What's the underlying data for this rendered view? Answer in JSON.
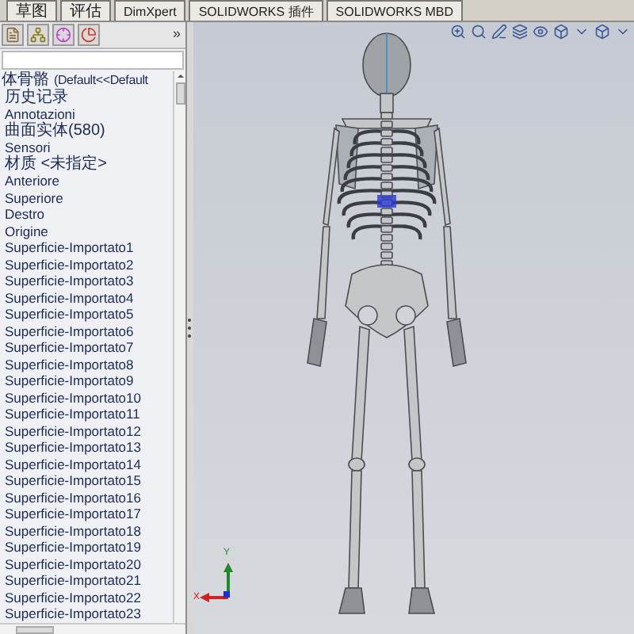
{
  "tabs": [
    {
      "label": "草图"
    },
    {
      "label": "评估"
    },
    {
      "label": "DimXpert"
    },
    {
      "label": "SOLIDWORKS 插件"
    },
    {
      "label": "SOLIDWORKS MBD"
    }
  ],
  "panel_toolbar": {
    "more": "»"
  },
  "tree": {
    "root": {
      "label": "体骨骼",
      "configuration": "(Default<<Default"
    },
    "items": [
      "历史记录",
      "Annotazioni",
      "曲面实体(580)",
      "Sensori",
      "材质 <未指定>",
      "Anteriore",
      "Superiore",
      "Destro",
      "Origine",
      "Superficie-Importato1",
      "Superficie-Importato2",
      "Superficie-Importato3",
      "Superficie-Importato4",
      "Superficie-Importato5",
      "Superficie-Importato6",
      "Superficie-Importato7",
      "Superficie-Importato8",
      "Superficie-Importato9",
      "Superficie-Importato10",
      "Superficie-Importato11",
      "Superficie-Importato12",
      "Superficie-Importato13",
      "Superficie-Importato14",
      "Superficie-Importato15",
      "Superficie-Importato16",
      "Superficie-Importato17",
      "Superficie-Importato18",
      "Superficie-Importato19",
      "Superficie-Importato20",
      "Superficie-Importato21",
      "Superficie-Importato22",
      "Superficie-Importato23"
    ]
  },
  "triad": {
    "y_label": "Y",
    "x_label": "X"
  }
}
